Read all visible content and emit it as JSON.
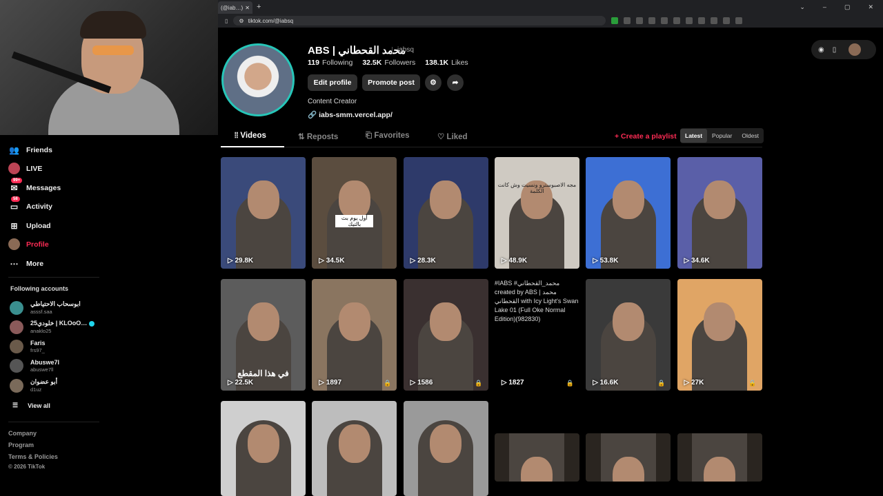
{
  "browser": {
    "tab_title": "(@iab…) محمد",
    "url": "tiktok.com/@iabsq"
  },
  "sidebar": {
    "items": [
      {
        "label": "Friends",
        "icon": "friends-icon"
      },
      {
        "label": "LIVE",
        "icon": "live-icon"
      },
      {
        "label": "Messages",
        "icon": "messages-icon",
        "badge": "99+"
      },
      {
        "label": "Activity",
        "icon": "activity-icon",
        "badge": "58"
      },
      {
        "label": "Upload",
        "icon": "upload-icon"
      },
      {
        "label": "Profile",
        "icon": "profile-avatar"
      },
      {
        "label": "More",
        "icon": "more-icon"
      }
    ],
    "following_title": "Following accounts",
    "accounts": [
      {
        "name": "ابوسحاب الاحتياطي",
        "user": "asssf.saa"
      },
      {
        "name": "خلودي25 | KLOoO…",
        "user": "anaklo25",
        "verified": true
      },
      {
        "name": "Faris",
        "user": "frs97_"
      },
      {
        "name": "Abuswe7l",
        "user": "abuswe7ll"
      },
      {
        "name": "أبو عضوان",
        "user": "d1uz"
      }
    ],
    "view_all": "View all",
    "footer": {
      "company": "Company",
      "program": "Program",
      "terms": "Terms & Policies",
      "copyright": "© 2026 TikTok"
    }
  },
  "profile": {
    "name": "ABS | محمد القحطاني",
    "username": "iabsq",
    "following_count": "119",
    "following_label": "Following",
    "followers_count": "32.5K",
    "followers_label": "Followers",
    "likes_count": "138.1K",
    "likes_label": "Likes",
    "edit_label": "Edit profile",
    "promote_label": "Promote post",
    "bio": "Content Creator",
    "link": "iabs-smm.vercel.app/"
  },
  "tabs": {
    "videos": "Videos",
    "reposts": "Reposts",
    "favorites": "Favorites",
    "liked": "Liked",
    "create_playlist": "+ Create a playlist",
    "sort": {
      "latest": "Latest",
      "popular": "Popular",
      "oldest": "Oldest"
    }
  },
  "videos": [
    {
      "views": "29.8K",
      "bg": "#3a4a7a"
    },
    {
      "views": "34.5K",
      "bg": "#5b4d3f",
      "caption": "أول يوم بث بالتيك"
    },
    {
      "views": "28.3K",
      "bg": "#2e3a6a"
    },
    {
      "views": "48.9K",
      "bg": "#cfcac2",
      "caption": "مجه الاصبوسترو ونسيت وش كانت الكلمة"
    },
    {
      "views": "53.8K",
      "bg": "#3d6fd4"
    },
    {
      "views": "34.6K",
      "bg": "#5a5fa8"
    },
    {
      "views": "22.5K",
      "bg": "#5c5c5c",
      "caption": "في هذا المقطع"
    },
    {
      "views": "1897",
      "bg": "#8a7560",
      "locked": true
    },
    {
      "views": "1586",
      "bg": "#3a3030",
      "locked": true
    },
    {
      "views": "1827",
      "bg": "#000000",
      "locked": true,
      "alt": "#IABS #محمد_القحطاني created by ABS | محمد القحطاني with Icy Light's Swan Lake 01 (Full Oke Normal Edition)(982830)"
    },
    {
      "views": "16.6K",
      "bg": "#3a3a3a",
      "locked": true
    },
    {
      "views": "27K",
      "bg": "#e0a565",
      "locked": true
    },
    {
      "views": "",
      "bg": "#cfcfcf"
    },
    {
      "views": "",
      "bg": "#bdbdbd"
    },
    {
      "views": "",
      "bg": "#9a9a9a"
    },
    {
      "views": "",
      "bg": "#2a2520"
    },
    {
      "views": "",
      "bg": "#2a2520"
    },
    {
      "views": "",
      "bg": "#2a2520"
    }
  ]
}
